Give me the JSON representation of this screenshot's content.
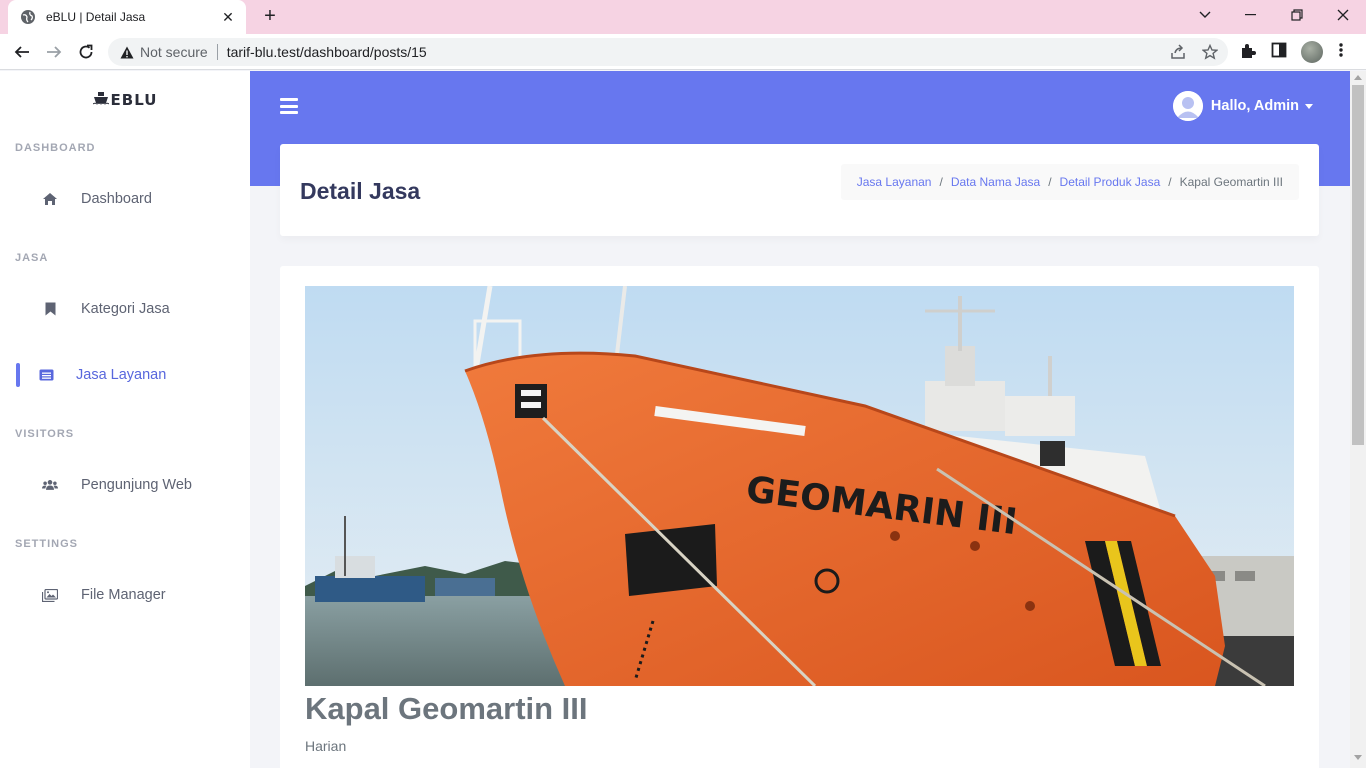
{
  "browser": {
    "tab_title": "eBLU | Detail Jasa",
    "security_label": "Not secure",
    "url": "tarif-blu.test/dashboard/posts/15"
  },
  "sidebar": {
    "brand": "EBLU",
    "sections": [
      {
        "heading": "DASHBOARD",
        "items": [
          {
            "label": "Dashboard",
            "icon": "home-icon"
          }
        ]
      },
      {
        "heading": "JASA",
        "items": [
          {
            "label": "Kategori Jasa",
            "icon": "bookmark-icon"
          },
          {
            "label": "Jasa Layanan",
            "icon": "list-icon",
            "active": true
          }
        ]
      },
      {
        "heading": "VISITORS",
        "items": [
          {
            "label": "Pengunjung Web",
            "icon": "users-icon"
          }
        ]
      },
      {
        "heading": "SETTINGS",
        "items": [
          {
            "label": "File Manager",
            "icon": "images-icon"
          }
        ]
      }
    ]
  },
  "topbar": {
    "user_greeting": "Hallo, Admin"
  },
  "header": {
    "title": "Detail Jasa",
    "breadcrumb": [
      "Jasa Layanan",
      "Data Nama Jasa",
      "Detail Produk Jasa",
      "Kapal Geomartin III"
    ]
  },
  "post": {
    "ship_hull_text": "GEOMARIN III",
    "title": "Kapal Geomartin III",
    "subtitle": "Harian"
  },
  "colors": {
    "primary": "#6777ef",
    "hull": "#e8642a"
  }
}
